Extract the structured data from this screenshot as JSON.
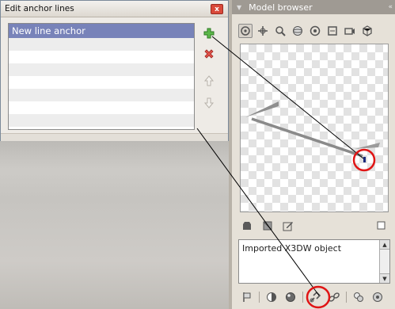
{
  "anchor_window": {
    "title": "Edit anchor lines",
    "close_glyph": "x",
    "items": [
      "New line anchor",
      "",
      "",
      "",
      "",
      "",
      "",
      ""
    ],
    "buttons": [
      {
        "name": "add-anchor-button",
        "icon": "plus-icon"
      },
      {
        "name": "delete-anchor-button",
        "icon": "cross-icon"
      },
      {
        "name": "move-up-button",
        "icon": "arrow-up-icon"
      },
      {
        "name": "move-down-button",
        "icon": "arrow-down-icon"
      }
    ]
  },
  "model_browser": {
    "title": "Model browser",
    "collapse_glyph": "▼",
    "dock_glyph": "«",
    "toolbar": [
      "orbit-icon",
      "pan-icon",
      "zoom-icon",
      "sphere-icon",
      "target-icon",
      "frame-icon",
      "camera-icon",
      "cube-icon"
    ],
    "viewport_toolbar": [
      "solid-icon",
      "wireframe-icon",
      "edit-icon",
      "maximize-icon"
    ],
    "description": "Imported X3DW object",
    "bottom_toolbar": [
      "flag-icon",
      "contrast-icon",
      "material-icon",
      "anchor-link-icon",
      "link-icon",
      "layers-icon",
      "settings-icon"
    ]
  },
  "highlight_color": "#e01515"
}
